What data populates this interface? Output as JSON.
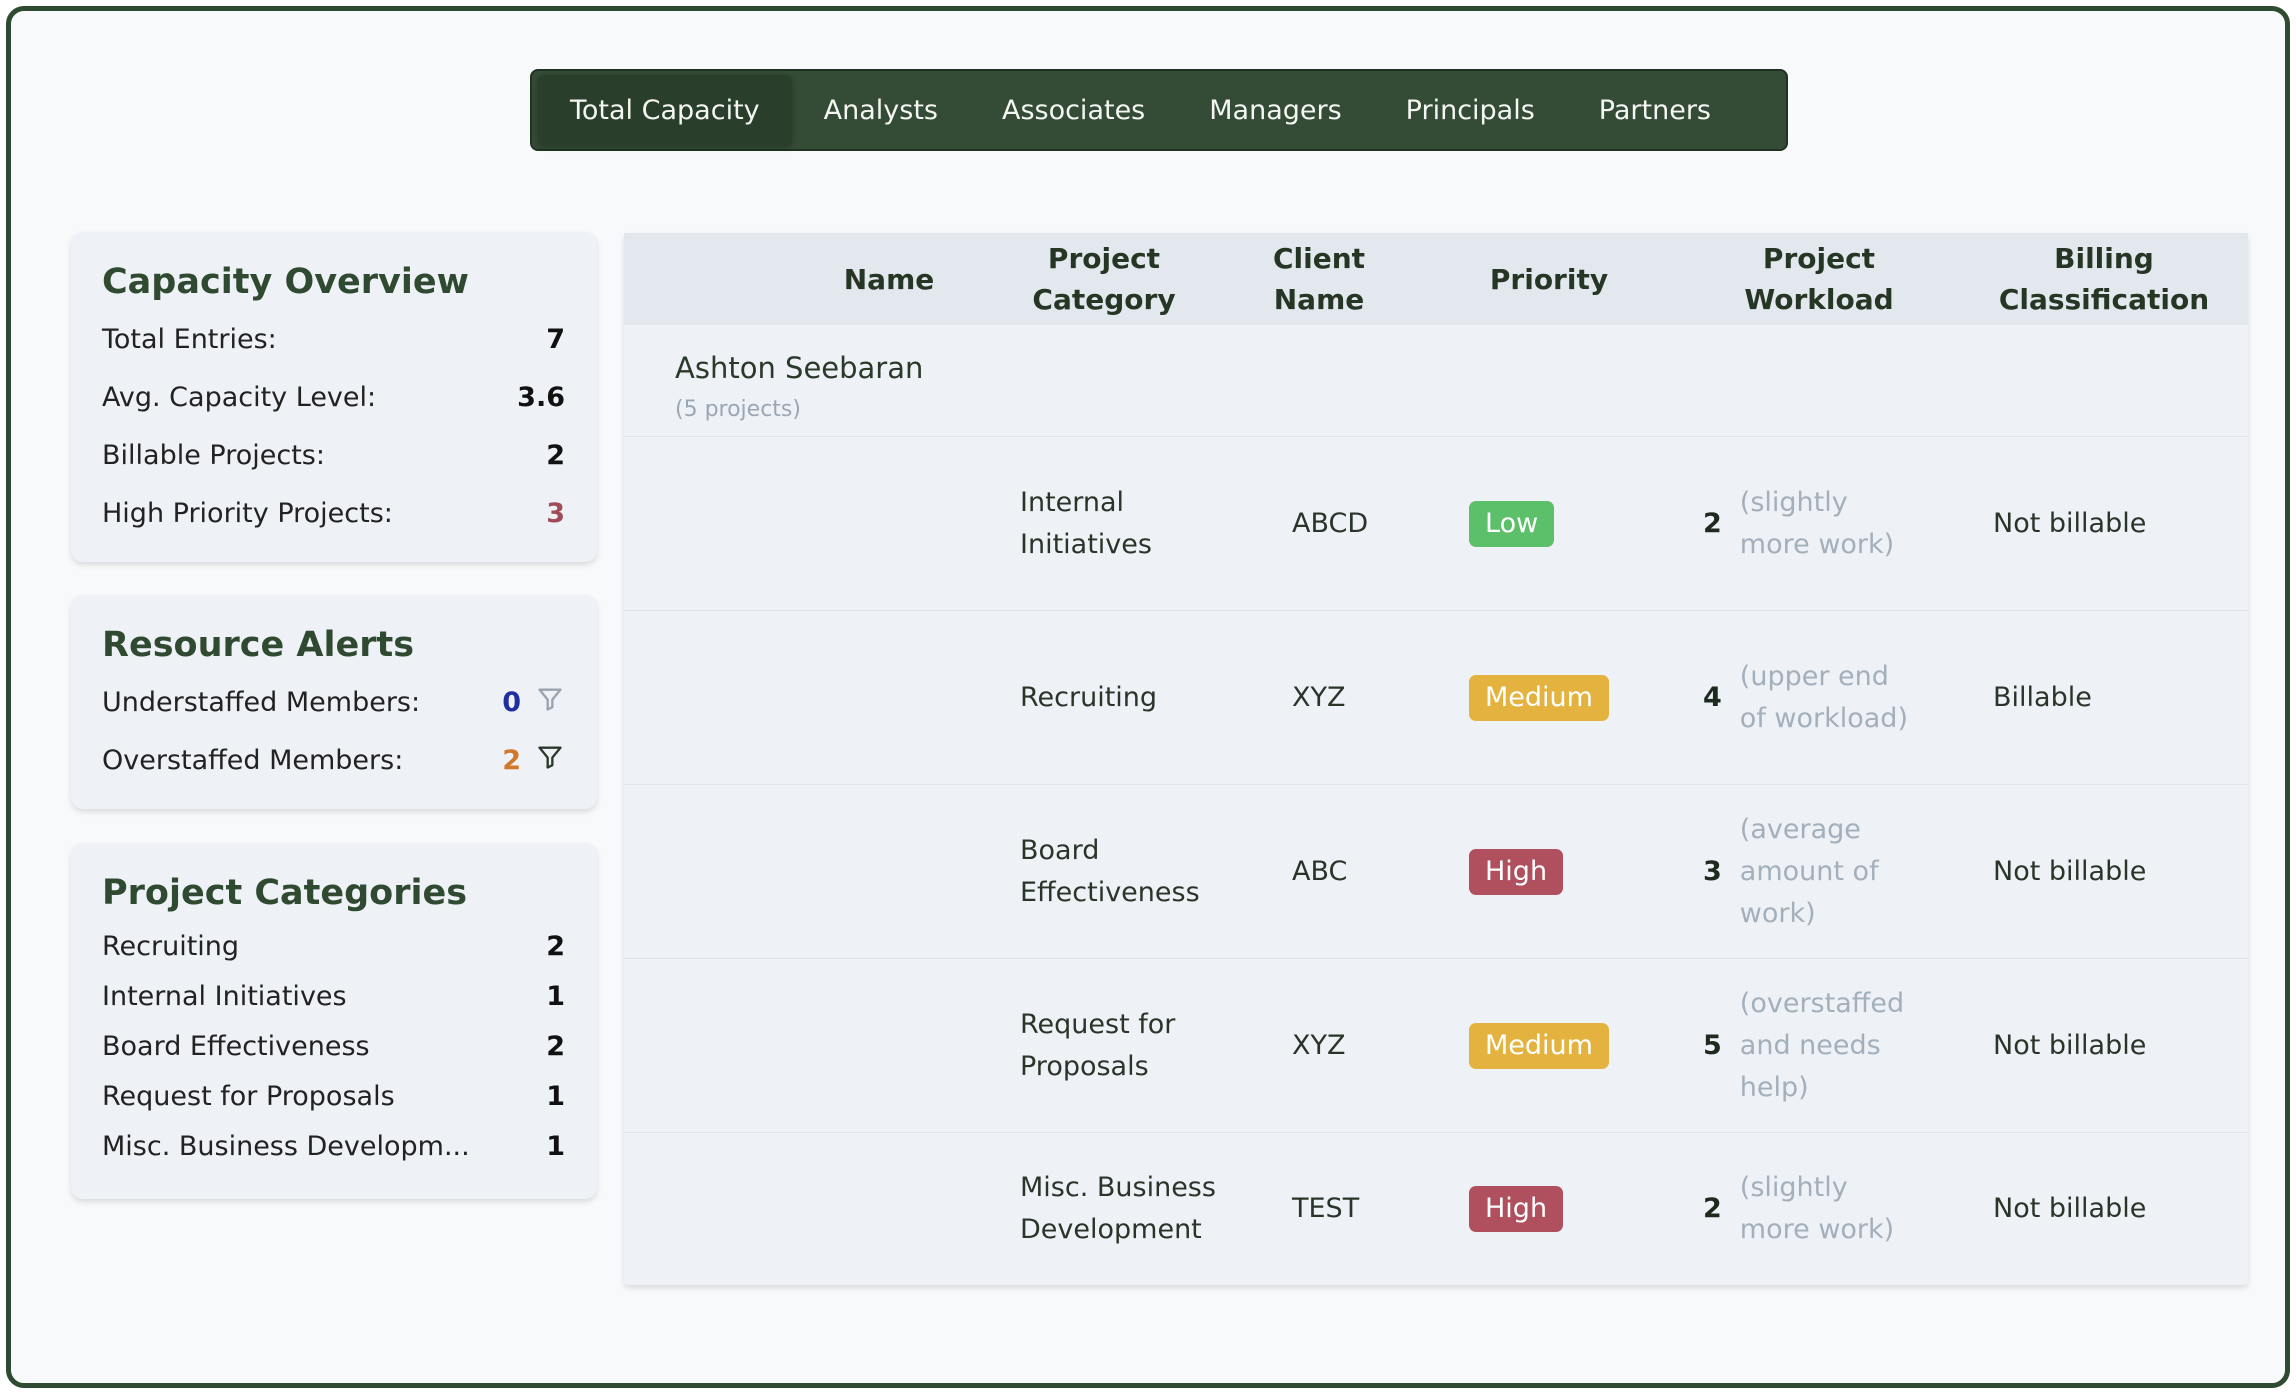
{
  "tabs": [
    {
      "label": "Total Capacity",
      "active": true
    },
    {
      "label": "Analysts",
      "active": false
    },
    {
      "label": "Associates",
      "active": false
    },
    {
      "label": "Managers",
      "active": false
    },
    {
      "label": "Principals",
      "active": false
    },
    {
      "label": "Partners",
      "active": false
    }
  ],
  "capacity_overview": {
    "title": "Capacity Overview",
    "items": [
      {
        "label": "Total Entries:",
        "value": "7"
      },
      {
        "label": "Avg. Capacity Level:",
        "value": "3.6"
      },
      {
        "label": "Billable Projects:",
        "value": "2"
      },
      {
        "label": "High Priority Projects:",
        "value": "3"
      }
    ]
  },
  "resource_alerts": {
    "title": "Resource Alerts",
    "items": [
      {
        "label": "Understaffed Members:",
        "value": "0",
        "icon": "filter-icon"
      },
      {
        "label": "Overstaffed Members:",
        "value": "2",
        "icon": "filter-icon"
      }
    ]
  },
  "project_categories": {
    "title": "Project Categories",
    "items": [
      {
        "label": "Recruiting",
        "value": "2"
      },
      {
        "label": "Internal Initiatives",
        "value": "1"
      },
      {
        "label": "Board Effectiveness",
        "value": "2"
      },
      {
        "label": "Request for Proposals",
        "value": "1"
      },
      {
        "label": "Misc. Business Developm...",
        "value": "1"
      }
    ]
  },
  "table": {
    "headers": {
      "name": "Name",
      "category": "Project Category",
      "client": "Client Name",
      "priority": "Priority",
      "workload": "Project Workload",
      "billing": "Billing Classification"
    },
    "group": {
      "name": "Ashton Seebaran",
      "count": "(5 projects)"
    },
    "rows": [
      {
        "category": "Internal Initiatives",
        "client": "ABCD",
        "priority": "Low",
        "workload": "2",
        "workload_desc": "(slightly more work)",
        "billing": "Not billable"
      },
      {
        "category": "Recruiting",
        "client": "XYZ",
        "priority": "Medium",
        "workload": "4",
        "workload_desc": "(upper end of workload)",
        "billing": "Billable"
      },
      {
        "category": "Board Effectiveness",
        "client": "ABC",
        "priority": "High",
        "workload": "3",
        "workload_desc": "(average amount of work)",
        "billing": "Not billable"
      },
      {
        "category": "Request for Proposals",
        "client": "XYZ",
        "priority": "Medium",
        "workload": "5",
        "workload_desc": "(overstaffed and needs help)",
        "billing": "Not billable"
      },
      {
        "category": "Misc. Business Development",
        "client": "TEST",
        "priority": "High",
        "workload": "2",
        "workload_desc": "(slightly more work)",
        "billing": "Not billable"
      }
    ]
  },
  "colors": {
    "brand": "#344b35",
    "priority_low": "#5cbf6a",
    "priority_medium": "#e4b33f",
    "priority_high": "#b0505f",
    "high_priority_value": "#a24a57",
    "understaffed_value": "#1f2fa0",
    "overstaffed_value": "#d2782a"
  }
}
